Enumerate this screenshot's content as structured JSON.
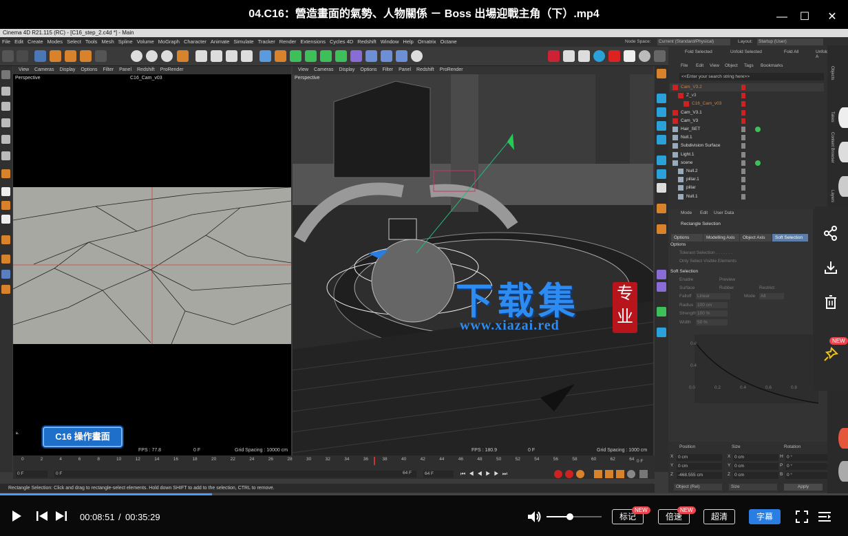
{
  "player": {
    "title": "04.C16：營造畫面的氣勢、人物關係 － Boss 出場迎戰主角（下）.mp4",
    "minimize": "—",
    "maximize": "☐",
    "close": "✕"
  },
  "c4d": {
    "window_title": "Cinema 4D R21.115 (RC) - [C16_step_2.c4d *] - Main",
    "menu": [
      "File",
      "Edit",
      "Create",
      "Modes",
      "Select",
      "Tools",
      "Mesh",
      "Spline",
      "Volume",
      "MoGraph",
      "Character",
      "Animate",
      "Simulate",
      "Tracker",
      "Render",
      "Extensions",
      "Cycles 4D",
      "Redshift",
      "Window",
      "Help",
      "Ornatrix",
      "Octane"
    ],
    "node_space_label": "Node Space:",
    "node_space_value": "Current (Standard/Physical)",
    "layout_label": "Layout:",
    "layout_value": "Startup (User)",
    "viewport_menu": [
      "View",
      "Cameras",
      "Display",
      "Options",
      "Filter",
      "Panel",
      "Redshift",
      "ProRender"
    ],
    "vp_left": {
      "label": "Perspective",
      "camera": "C16_Cam_v03",
      "fps": "FPS : 77.8",
      "frame": "0 F",
      "grid": "Grid Spacing : 10000 cm"
    },
    "vp_right": {
      "label": "Perspective",
      "fps": "FPS : 180.9",
      "frame": "0 F",
      "grid": "Grid Spacing : 1000 cm"
    },
    "overlay_label": "C16 操作畫面",
    "objmgr": {
      "toolbar": [
        "Fold Selected",
        "Unfold Selected",
        "Fold All",
        "Unfold A"
      ],
      "menu": [
        "File",
        "Edit",
        "View",
        "Object",
        "Tags",
        "Bookmarks"
      ],
      "search_placeholder": "<<Enter your search string here>>",
      "objects": [
        "Cam_V3.2",
        "Z_v3",
        "C16_Cam_v03",
        "Cam_V3.1",
        "Cam_V3",
        "Hair_SET",
        "Null.1",
        "Subdivision Surface",
        "Light.1",
        "scene",
        "Null.2",
        "pillar.1",
        "pillar",
        "Null.1"
      ],
      "side_tabs": [
        "Objects",
        "Takes",
        "Content Browser",
        "Layers"
      ]
    },
    "attr": {
      "menu": [
        "Mode",
        "Edit",
        "User Data"
      ],
      "title": "Rectangle Selection",
      "tabs": [
        "Options",
        "Modelling Axis",
        "Object Axis",
        "Soft Selection"
      ],
      "options_header": "Options",
      "tolerant": "Tolerant Selection . . . . . . .",
      "visible_only": "Only Select Visible Elements",
      "soft_header": "Soft Selection",
      "enable": "Enable",
      "preview": "Preview",
      "surface": "Surface",
      "rubber": "Rubber",
      "restrict": "Restrict",
      "falloff_label": "Falloff",
      "falloff_value": "Linear",
      "mode_label": "Mode",
      "mode_value": "All",
      "radius_label": "Radius",
      "radius_value": "100 cm",
      "strength_label": "Strength",
      "strength_value": "100 %",
      "width_label": "Width",
      "width_value": "50 %",
      "graph_y": [
        "0.8",
        "0.4"
      ],
      "graph_x": [
        "0.0",
        "0.2",
        "0.4",
        "0.6",
        "0.8",
        "1.0"
      ]
    },
    "coords": {
      "headers": [
        "Position",
        "Size",
        "Rotation"
      ],
      "rows": [
        [
          "X",
          "0 cm",
          "X",
          "0 cm",
          "H",
          "0 °"
        ],
        [
          "Y",
          "0 cm",
          "Y",
          "0 cm",
          "P",
          "0 °"
        ],
        [
          "Z",
          "-468.555 cm",
          "Z",
          "0 cm",
          "B",
          "0 °"
        ]
      ],
      "object_mode": "Object (Rel)",
      "size_mode": "Size",
      "apply": "Apply"
    },
    "timeline": {
      "ticks": [
        "0",
        "2",
        "4",
        "6",
        "8",
        "10",
        "12",
        "14",
        "16",
        "18",
        "20",
        "22",
        "24",
        "26",
        "28",
        "30",
        "32",
        "34",
        "36",
        "38",
        "40",
        "42",
        "44",
        "46",
        "48",
        "50",
        "52",
        "54",
        "56",
        "58",
        "60",
        "62",
        "64"
      ],
      "end_frame": "0 F",
      "start": "0 F",
      "current": "0 F",
      "max1": "64 F",
      "max2": "64 F"
    },
    "status": "Rectangle Selection: Click and drag to rectangle-select elements. Hold down SHIFT to add to the selection, CTRL to remove."
  },
  "watermark": {
    "main": "下载集",
    "url": "www.xiazai.red",
    "seal": "专业"
  },
  "side_actions": {
    "new_badge": "NEW"
  },
  "controls": {
    "current_time": "00:08:51",
    "separator": "/",
    "total_time": "00:35:29",
    "mark": "标记",
    "speed": "倍速",
    "quality": "超清",
    "subtitle": "字幕",
    "new": "NEW"
  }
}
